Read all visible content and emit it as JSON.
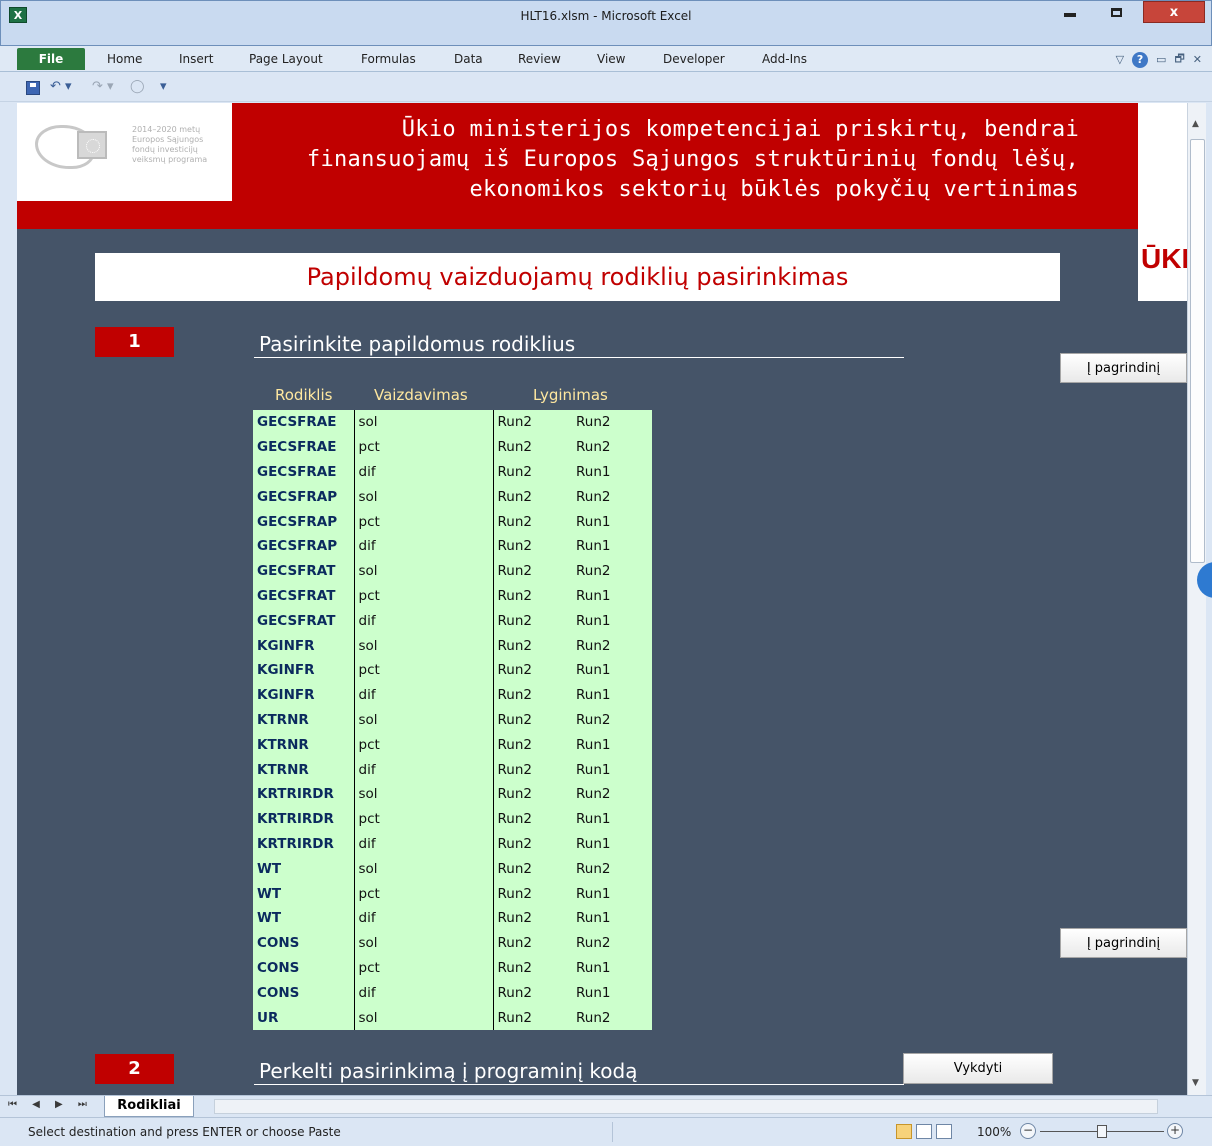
{
  "window": {
    "title": "HLT16.xlsm  -  Microsoft Excel",
    "app_icon": "X",
    "controls": {
      "minimize_icon": "minimize-icon",
      "maximize_icon": "maximize-icon",
      "close_label": "x"
    }
  },
  "ribbon": {
    "file_tab": "File",
    "tabs": [
      "Home",
      "Insert",
      "Page Layout",
      "Formulas",
      "Data",
      "Review",
      "View",
      "Developer",
      "Add-Ins"
    ],
    "right_glyphs": {
      "collapse": "▽",
      "help": "?",
      "min": "▭",
      "restore": "🗗",
      "close": "✕"
    }
  },
  "qat": {
    "undo": "↶ ▾",
    "redo": "↷ ▾",
    "circle": "◯",
    "customize": "▾"
  },
  "banner": {
    "logo_text": [
      "2014–2020 metų",
      "Europos Sąjungos",
      "fondų investicijų",
      "veiksmų programa"
    ],
    "title_lines": [
      "Ūkio ministerijos kompetencijai priskirtų, bendrai",
      "finansuojamų iš Europos Sąjungos struktūrinių fondų lėšų,",
      "ekonomikos sektorių būklės pokyčių vertinimas"
    ]
  },
  "right_partial_text": "ŪKI",
  "subtitle": "Papildomų vaizduojamų rodiklių pasirinkimas",
  "section1": {
    "number": "1",
    "title": "Pasirinkite papildomus rodiklius"
  },
  "section2": {
    "number": "2",
    "title": "Perkelti pasirinkimą į programinį kodą"
  },
  "buttons": {
    "to_main_top": "Į pagrindinį",
    "to_main_bottom": "Į pagrindinį",
    "execute": "Vykdyti"
  },
  "table": {
    "headers": {
      "rodiklis": "Rodiklis",
      "vaizdavimas": "Vaizdavimas",
      "lyginimas": "Lyginimas"
    },
    "rows": [
      [
        "GECSFRAE",
        "sol",
        "Run2",
        "Run2"
      ],
      [
        "GECSFRAE",
        "pct",
        "Run2",
        "Run2"
      ],
      [
        "GECSFRAE",
        "dif",
        "Run2",
        "Run1"
      ],
      [
        "GECSFRAP",
        "sol",
        "Run2",
        "Run2"
      ],
      [
        "GECSFRAP",
        "pct",
        "Run2",
        "Run1"
      ],
      [
        "GECSFRAP",
        "dif",
        "Run2",
        "Run1"
      ],
      [
        "GECSFRAT",
        "sol",
        "Run2",
        "Run2"
      ],
      [
        "GECSFRAT",
        "pct",
        "Run2",
        "Run1"
      ],
      [
        "GECSFRAT",
        "dif",
        "Run2",
        "Run1"
      ],
      [
        "KGINFR",
        "sol",
        "Run2",
        "Run2"
      ],
      [
        "KGINFR",
        "pct",
        "Run2",
        "Run1"
      ],
      [
        "KGINFR",
        "dif",
        "Run2",
        "Run1"
      ],
      [
        "KTRNR",
        "sol",
        "Run2",
        "Run2"
      ],
      [
        "KTRNR",
        "pct",
        "Run2",
        "Run1"
      ],
      [
        "KTRNR",
        "dif",
        "Run2",
        "Run1"
      ],
      [
        "KRTRIRDR",
        "sol",
        "Run2",
        "Run2"
      ],
      [
        "KRTRIRDR",
        "pct",
        "Run2",
        "Run1"
      ],
      [
        "KRTRIRDR",
        "dif",
        "Run2",
        "Run1"
      ],
      [
        "WT",
        "sol",
        "Run2",
        "Run2"
      ],
      [
        "WT",
        "pct",
        "Run2",
        "Run1"
      ],
      [
        "WT",
        "dif",
        "Run2",
        "Run1"
      ],
      [
        "CONS",
        "sol",
        "Run2",
        "Run2"
      ],
      [
        "CONS",
        "pct",
        "Run2",
        "Run1"
      ],
      [
        "CONS",
        "dif",
        "Run2",
        "Run1"
      ],
      [
        "UR",
        "sol",
        "Run2",
        "Run2"
      ]
    ]
  },
  "sheet_tabs": {
    "nav": "⏮ ◀ ▶ ⏭",
    "active": "Rodikliai"
  },
  "status": {
    "message": "Select destination and press ENTER or choose Paste",
    "zoom": "100%",
    "zoom_minus": "−",
    "zoom_plus": "+"
  },
  "colors": {
    "banner_red": "#c00000",
    "sheet_bg": "#455468",
    "table_green": "#ccffcc",
    "header_yellow": "#ffe8a0"
  }
}
